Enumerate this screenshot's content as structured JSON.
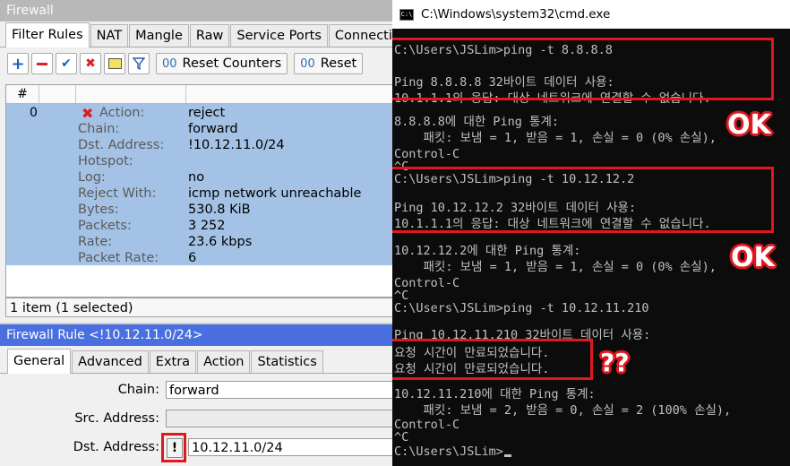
{
  "firewall": {
    "title": "Firewall",
    "tabs": [
      "Filter Rules",
      "NAT",
      "Mangle",
      "Raw",
      "Service Ports",
      "Connecti"
    ],
    "toolbar": {
      "reset_counters": "Reset Counters",
      "reset_all": "Reset"
    },
    "columns": [
      "#"
    ],
    "row": {
      "number": "0",
      "props": [
        {
          "key": "Action:",
          "value": "reject"
        },
        {
          "key": "Chain:",
          "value": "forward"
        },
        {
          "key": "Dst. Address:",
          "value": "!10.12.11.0/24"
        },
        {
          "key": "Hotspot:",
          "value": ""
        },
        {
          "key": "Log:",
          "value": "no"
        },
        {
          "key": "Reject With:",
          "value": "icmp network unreachable"
        },
        {
          "key": "Bytes:",
          "value": "530.8 KiB"
        },
        {
          "key": "Packets:",
          "value": "3 252"
        },
        {
          "key": "Rate:",
          "value": "23.6 kbps"
        },
        {
          "key": "Packet Rate:",
          "value": "6"
        }
      ]
    },
    "status": "1 item (1 selected)"
  },
  "rule": {
    "title": "Firewall Rule <!10.12.11.0/24>",
    "tabs": [
      "General",
      "Advanced",
      "Extra",
      "Action",
      "Statistics"
    ],
    "fields": {
      "chain_label": "Chain:",
      "chain_value": "forward",
      "src_label": "Src. Address:",
      "src_value": "",
      "dst_label": "Dst. Address:",
      "dst_invert": "!",
      "dst_value": "10.12.11.0/24"
    }
  },
  "cmd": {
    "title": "C:\\Windows\\system32\\cmd.exe",
    "lines": [
      "C:\\Users\\JSLim>ping -t 8.8.8.8",
      "",
      "Ping 8.8.8.8 32바이트 데이터 사용:",
      "10.1.1.1의 응답: 대상 네트워크에 연결할 수 없습니다.",
      "",
      "8.8.8.8에 대한 Ping 통계:",
      "    패킷: 보냄 = 1, 받음 = 1, 손실 = 0 (0% 손실),",
      "Control-C",
      "^C",
      "C:\\Users\\JSLim>ping -t 10.12.12.2",
      "",
      "Ping 10.12.12.2 32바이트 데이터 사용:",
      "10.1.1.1의 응답: 대상 네트워크에 연결할 수 없습니다.",
      "",
      "10.12.12.2에 대한 Ping 통계:",
      "    패킷: 보냄 = 1, 받음 = 1, 손실 = 0 (0% 손실),",
      "Control-C",
      "^C",
      "C:\\Users\\JSLim>ping -t 10.12.11.210",
      "",
      "Ping 10.12.11.210 32바이트 데이터 사용:",
      "요청 시간이 만료되었습니다.",
      "요청 시간이 만료되었습니다.",
      "",
      "10.12.11.210에 대한 Ping 통계:",
      "    패킷: 보냄 = 2, 받음 = 0, 손실 = 2 (100% 손실),",
      "Control-C",
      "^C",
      "C:\\Users\\JSLim>"
    ],
    "annotations": {
      "ok1": "OK",
      "ok2": "OK",
      "question": "??"
    }
  },
  "colors": {
    "highlight": "#e0181e",
    "selection": "#a3c2e6",
    "rule_title": "#4a6fe0"
  }
}
